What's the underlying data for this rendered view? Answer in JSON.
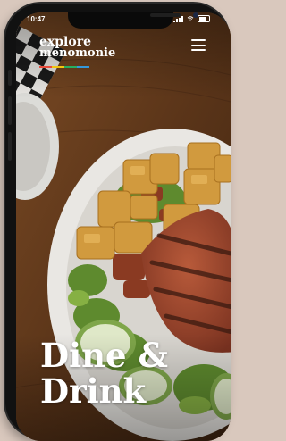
{
  "status_bar": {
    "time": "10:47"
  },
  "logo": {
    "line1": "explore",
    "line2": "menomonie"
  },
  "logo_colors": [
    "#e74c3c",
    "#f1c40f",
    "#27ae60",
    "#3498db"
  ],
  "header": {
    "menu_icon": "hamburger-menu-icon"
  },
  "hero": {
    "line1": "Dine &",
    "line2": "Drink"
  }
}
